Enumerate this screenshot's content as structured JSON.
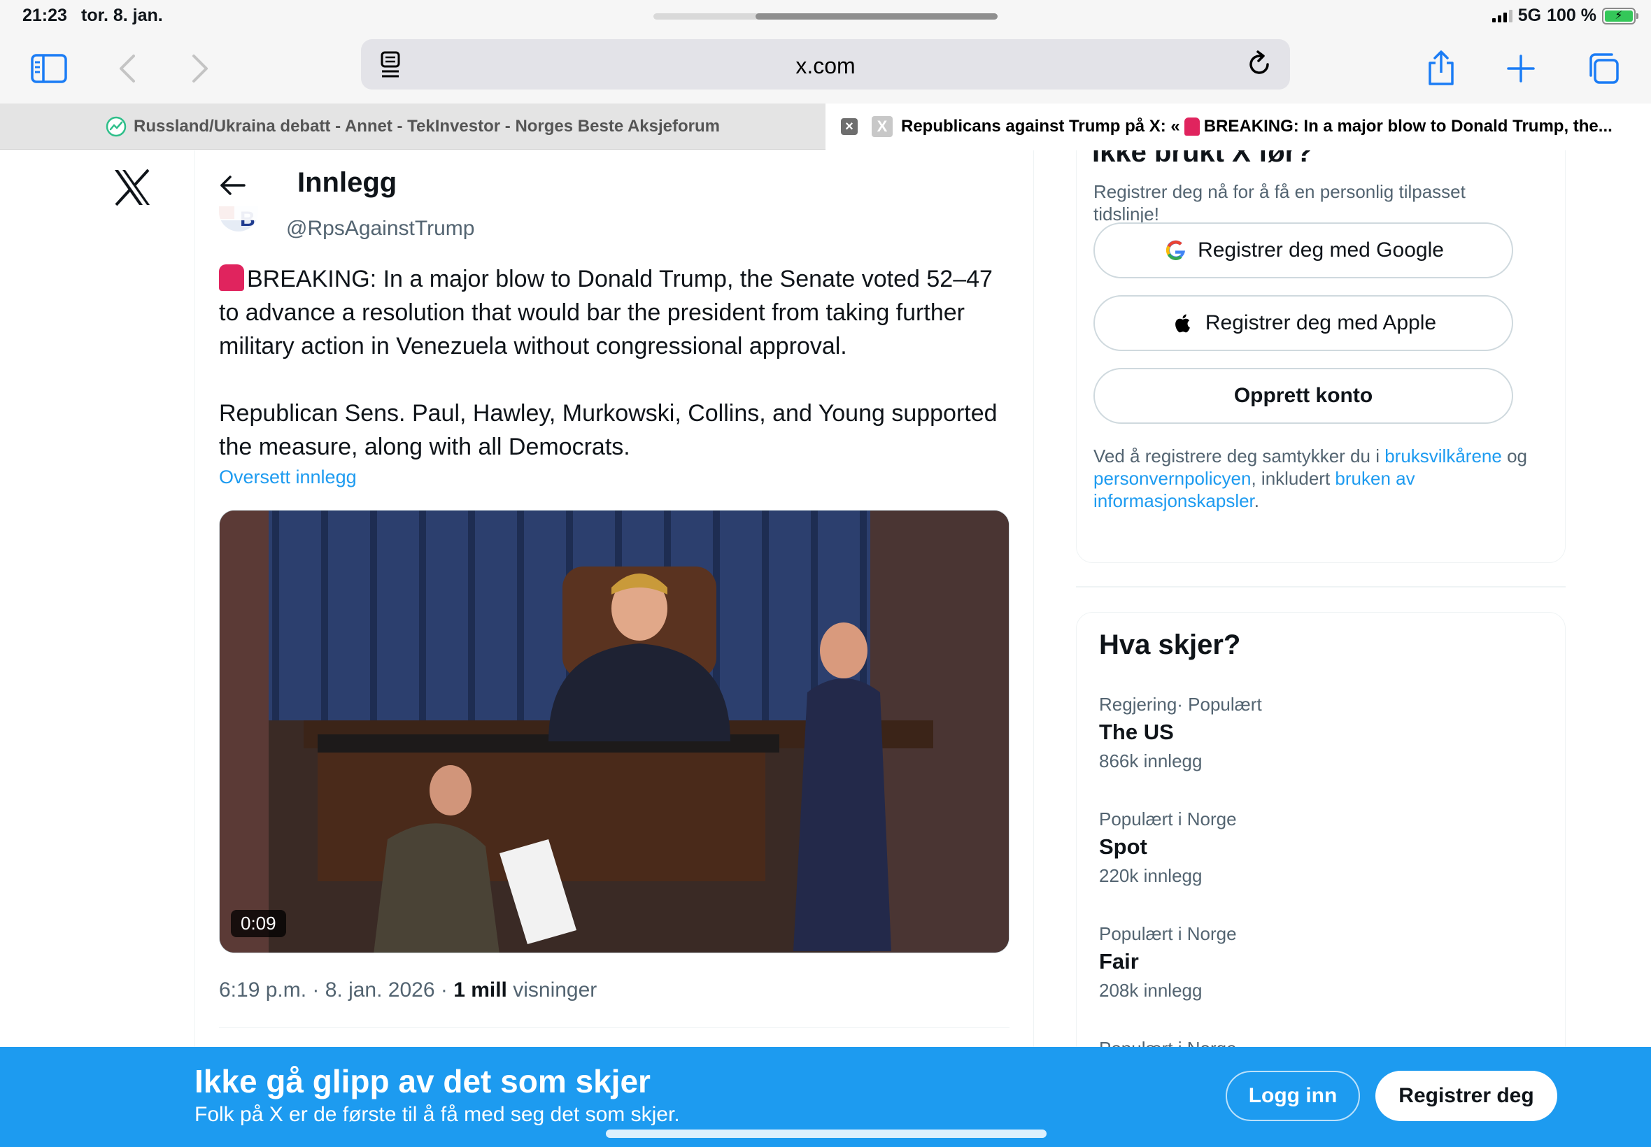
{
  "status_bar": {
    "time": "21:23",
    "date": "tor. 8. jan.",
    "network": "5G",
    "battery": "100 %"
  },
  "browser": {
    "url": "x.com",
    "icons": {
      "sidebar": "sidebar-icon",
      "back": "chevron-left-icon",
      "forward": "chevron-right-icon",
      "reader": "reader-icon",
      "reload": "reload-icon",
      "share": "share-icon",
      "new_tab": "plus-icon",
      "tabs": "tabs-icon"
    },
    "tabs": [
      {
        "label": "Russland/Ukraina debatt - Annet - TekInvestor - Norges Beste Aksjeforum",
        "active": false
      },
      {
        "label_prefix": "Republicans against Trump på X: «",
        "label_suffix": "BREAKING: In a major blow to Donald Trump, the...",
        "active": true
      }
    ]
  },
  "post": {
    "header_title": "Innlegg",
    "handle": "@RpsAgainstTrump",
    "paragraph1": "BREAKING: In a major blow to Donald Trump, the Senate voted 52–47 to advance a resolution that would bar the president from taking further military action in Venezuela without congressional approval.",
    "paragraph2": "Republican Sens. Paul, Hawley, Murkowski, Collins, and Young supported the measure, along with all Democrats.",
    "translate_label": "Oversett innlegg",
    "video_duration": "0:09",
    "timestamp": "6:19 p.m. · 8. jan. 2026 · ",
    "views_count": "1 mill",
    "views_label": " visninger"
  },
  "signup": {
    "heading": "Ikke brukt X før?",
    "subtitle": "Registrer deg nå for å få en personlig tilpasset tidslinje!",
    "google_button": "Registrer deg med Google",
    "apple_button": "Registrer deg med Apple",
    "create_button": "Opprett konto",
    "legal_1": "Ved å registrere deg samtykker du i ",
    "legal_link_terms": "bruksvilkårene",
    "legal_2": " og ",
    "legal_link_privacy": "personvernpolicyen",
    "legal_3": ", inkludert ",
    "legal_link_cookies": "bruken av informasjonskapsler",
    "legal_4": "."
  },
  "trends": {
    "title": "Hva skjer?",
    "items": [
      {
        "context": "Regjering· Populært",
        "name": "The US",
        "count": "866k innlegg"
      },
      {
        "context": "Populært i Norge",
        "name": "Spot",
        "count": "220k innlegg"
      },
      {
        "context": "Populært i Norge",
        "name": "Fair",
        "count": "208k innlegg"
      },
      {
        "context": "Populært i Norge",
        "name": "",
        "count": ""
      }
    ]
  },
  "banner": {
    "title": "Ikke gå glipp av det som skjer",
    "subtitle": "Folk på X er de første til å få med seg det som skjer.",
    "login_button": "Logg inn",
    "register_button": "Registrer deg"
  },
  "colors": {
    "accent": "#1d9bf0",
    "safari_blue": "#1a7cf5",
    "text_secondary": "#536471",
    "siren": "#e0245e"
  }
}
